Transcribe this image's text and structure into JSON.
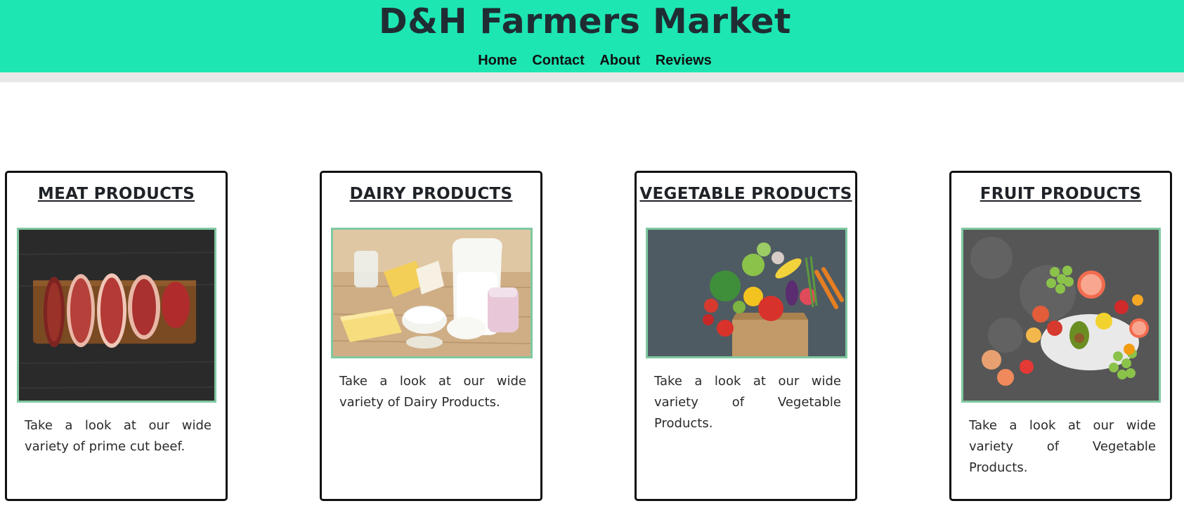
{
  "header": {
    "title": "D&H Farmers Market",
    "bg_color": "#1de6b3",
    "nav": [
      {
        "label": "Home"
      },
      {
        "label": "Contact"
      },
      {
        "label": "About"
      },
      {
        "label": "Reviews"
      }
    ]
  },
  "cards": [
    {
      "title": "MEAT PRODUCTS",
      "text": "Take a look at our wide variety of prime cut beef.",
      "image": "meat-photo"
    },
    {
      "title": "DAIRY PRODUCTS",
      "text": "Take a look at our wide variety of Dairy Products.",
      "image": "dairy-photo"
    },
    {
      "title": "VEGETABLE PRODUCTS",
      "text": "Take a look at our wide variety of Vegetable Products.",
      "image": "vegetable-photo"
    },
    {
      "title": "FRUIT PRODUCTS",
      "text": "Take a look at our wide variety of Vegetable Products.",
      "image": "fruit-photo"
    }
  ],
  "colors": {
    "accent": "#1de6b3",
    "image_border": "#7fc8a0",
    "card_border": "#111111"
  }
}
